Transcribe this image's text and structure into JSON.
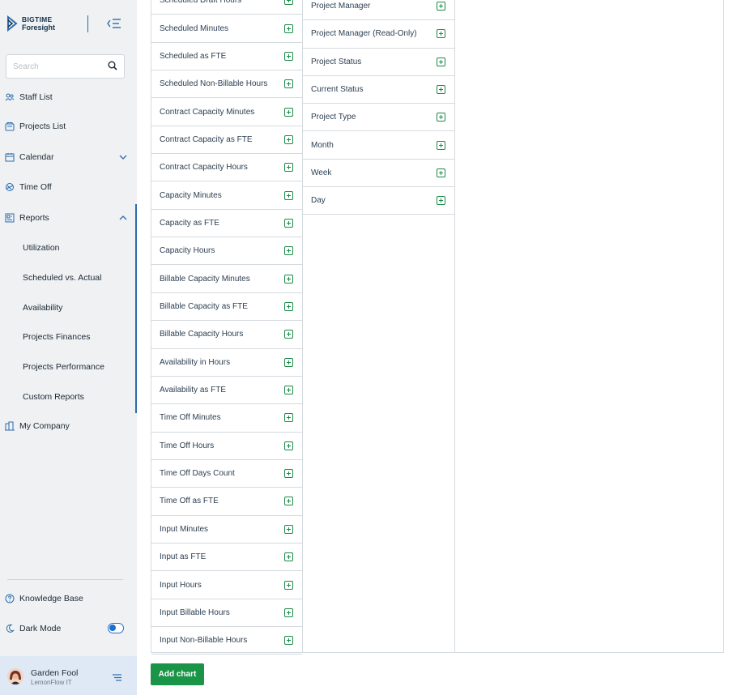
{
  "app": {
    "logo_line1": "BIGTIME",
    "logo_line2": "Foresight",
    "accent": "#2b6cb0",
    "success": "#1a9446"
  },
  "search": {
    "placeholder": "Search"
  },
  "nav": {
    "staff_list": "Staff List",
    "projects_list": "Projects List",
    "calendar": "Calendar",
    "time_off": "Time Off",
    "reports": "Reports",
    "my_company": "My Company",
    "knowledge_base": "Knowledge Base",
    "dark_mode": "Dark Mode",
    "report_items": [
      "Utilization",
      "Scheduled vs. Actual",
      "Availability",
      "Projects Finances",
      "Projects Performance",
      "Custom Reports"
    ]
  },
  "user": {
    "name": "Garden Fool",
    "company": "LemonFlow IT"
  },
  "metrics_column": [
    "Scheduled Draft Hours",
    "Scheduled Minutes",
    "Scheduled as FTE",
    "Scheduled Non-Billable Hours",
    "Contract Capacity Minutes",
    "Contract Capacity as FTE",
    "Contract Capacity Hours",
    "Capacity Minutes",
    "Capacity as FTE",
    "Capacity Hours",
    "Billable Capacity Minutes",
    "Billable Capacity as FTE",
    "Billable Capacity Hours",
    "Availability in Hours",
    "Availability as FTE",
    "Time Off Minutes",
    "Time Off Hours",
    "Time Off Days Count",
    "Time Off as FTE",
    "Input Minutes",
    "Input as FTE",
    "Input Hours",
    "Input Billable Hours",
    "Input Non-Billable Hours"
  ],
  "dimensions_column": [
    "Project Manager",
    "Project Manager (Read-Only)",
    "Project Status",
    "Current Status",
    "Project Type",
    "Month",
    "Week",
    "Day"
  ],
  "actions": {
    "add_chart": "Add chart"
  }
}
